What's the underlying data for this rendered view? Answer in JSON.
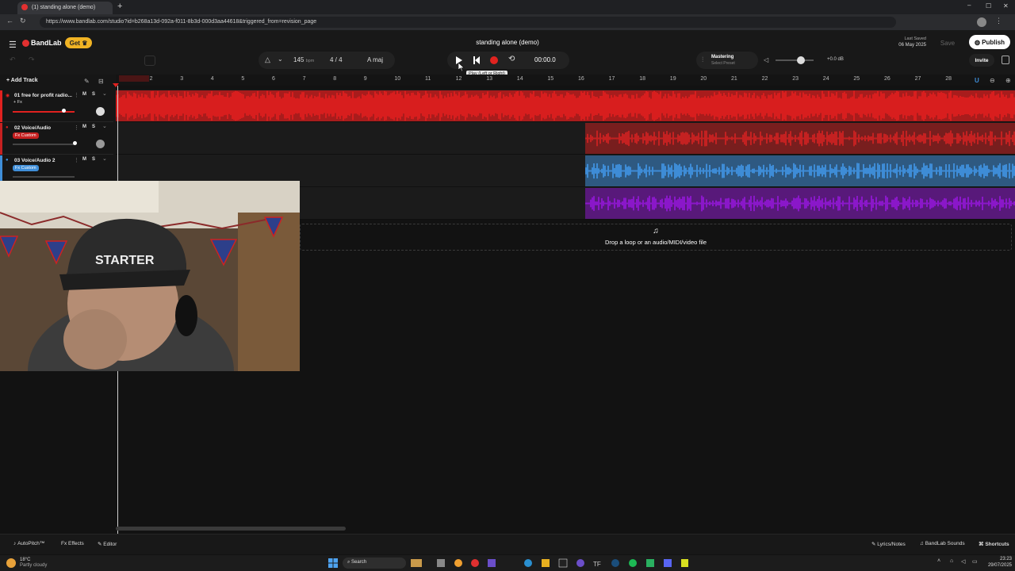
{
  "browser": {
    "tab_title": "(1) standing alone (demo)",
    "url": "https://www.bandlab.com/studio?id=b268a13d-092a-f011-8b3d-000d3aa44618&triggered_from=revision_page"
  },
  "header": {
    "logo": "BandLab",
    "get_label": "Get",
    "project_title": "standing alone (demo)",
    "last_saved_label": "Last Saved",
    "last_saved_date": "06 May 2025",
    "save_label": "Save",
    "publish_label": "Publish",
    "invite_label": "Invite"
  },
  "transport": {
    "bpm": "145",
    "bpm_unit": "bpm",
    "time_signature": "4 / 4",
    "key": "A maj",
    "time": "00:00.0",
    "play_tooltip": "Play (Left or Right)"
  },
  "mastering": {
    "label": "Mastering",
    "sub": "Select Preset",
    "db": "+0.0 dB"
  },
  "ruler": [
    "1",
    "2",
    "3",
    "4",
    "5",
    "6",
    "7",
    "8",
    "9",
    "10",
    "11",
    "12",
    "13",
    "14",
    "15",
    "16",
    "17",
    "18",
    "19",
    "20",
    "21",
    "22",
    "23",
    "24",
    "25",
    "26",
    "27",
    "28"
  ],
  "tracks_panel": {
    "add_track_label": "Add Track"
  },
  "tracks": [
    {
      "name": "01  free for profit radio...",
      "fx": "+ Fx",
      "mute": "M",
      "solo": "S",
      "color": "#e0211f"
    },
    {
      "name": "02  Voice/Audio",
      "fx": "Fx  Custom",
      "mute": "M",
      "solo": "S",
      "color": "#c62020"
    },
    {
      "name": "03  Voice/Audio 2",
      "fx": "Fx  Custom",
      "mute": "M",
      "solo": "S",
      "color": "#3f8ed8"
    }
  ],
  "lane_colors": [
    "#d81e1e",
    "#c42121",
    "#3e8cd6",
    "#8a17c9"
  ],
  "drop_zone": {
    "text": "Drop a loop or an audio/MIDI/video file"
  },
  "bottom_bar": {
    "autopitch": "AutoPitch™",
    "effects": "Effects",
    "editor": "Editor",
    "lyrics": "Lyrics/Notes",
    "sounds": "BandLab Sounds",
    "shortcuts": "Shortcuts"
  },
  "taskbar": {
    "weather_temp": "18°C",
    "weather_desc": "Partly cloudy",
    "search": "Search",
    "clock_time": "23:23",
    "clock_date": "29/07/2025"
  }
}
